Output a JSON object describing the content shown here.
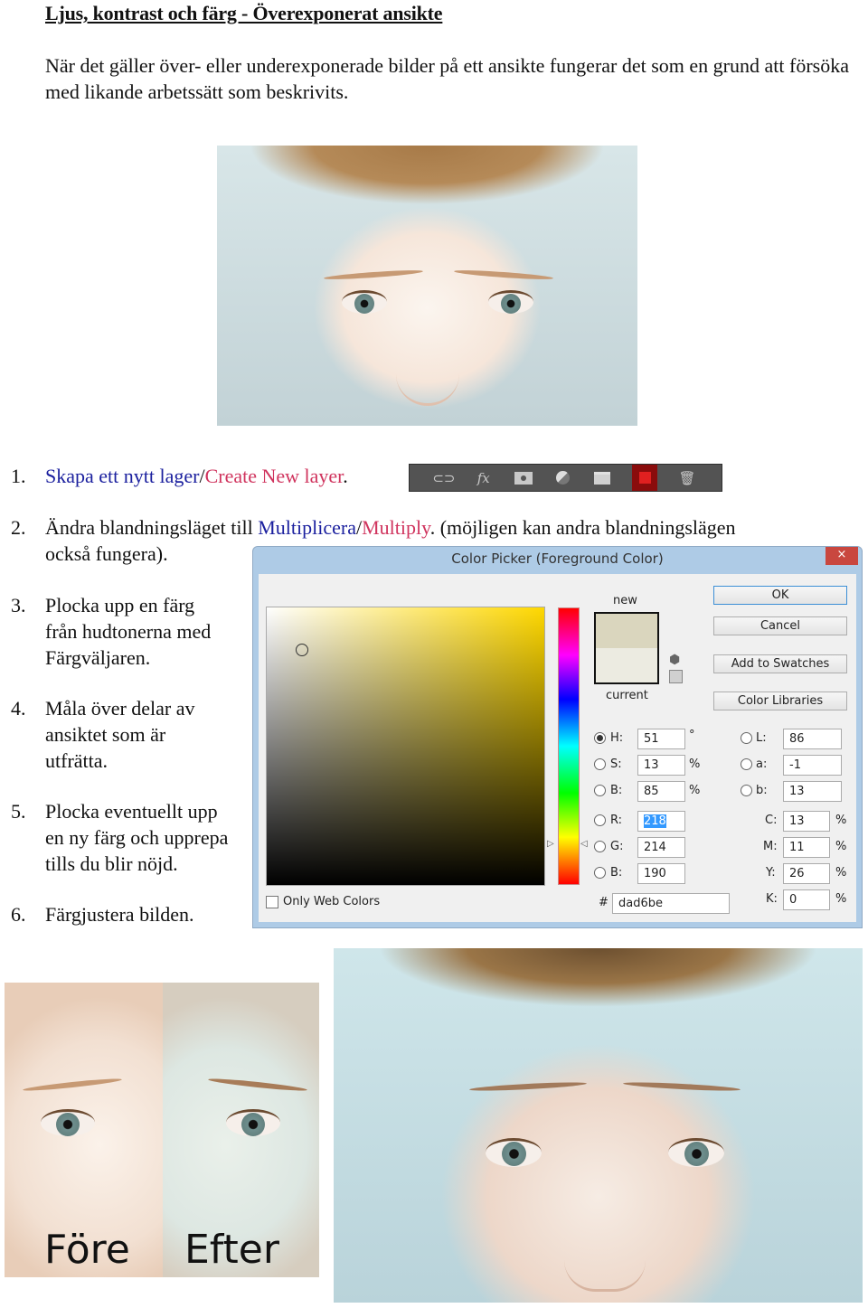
{
  "document": {
    "title": "Ljus, kontrast och färg   -  Överexponerat ansikte",
    "intro": "När det gäller över- eller underexponerade bilder på ett ansikte fungerar det som en grund att försöka med likande arbetssätt som beskrivits."
  },
  "steps": [
    {
      "num": "1.",
      "swedish": "Skapa ett nytt lager",
      "sep": "/",
      "english": "Create New layer",
      "tail": "."
    },
    {
      "num": "2.",
      "pre": "Ändra blandningsläget till ",
      "swedish": "Multiplicera",
      "sep": "/",
      "english": "Multiply",
      "tail": ". (möjligen kan andra blandningslägen",
      "line2": "också fungera)."
    },
    {
      "num": "3.",
      "lines": [
        "Plocka upp en färg",
        "från hudtonerna med",
        "Färgväljaren."
      ]
    },
    {
      "num": "4.",
      "lines": [
        "Måla över delar av",
        "ansiktet som är",
        "utfrätta."
      ]
    },
    {
      "num": "5.",
      "lines": [
        "Plocka eventuellt upp",
        "en ny färg och upprepa",
        "tills du blir nöjd."
      ]
    },
    {
      "num": "6.",
      "lines": [
        "Färgjustera bilden."
      ]
    }
  ],
  "layers_toolbar": {
    "icons": [
      "link-layers-icon",
      "fx-icon",
      "add-mask-icon",
      "adjustment-layer-icon",
      "group-folder-icon",
      "new-layer-icon",
      "trash-icon"
    ],
    "fx_label": "fx",
    "highlighted": "new-layer-icon"
  },
  "color_picker": {
    "title": "Color Picker (Foreground Color)",
    "close_label": "×",
    "new_label": "new",
    "current_label": "current",
    "new_color": "#dad6be",
    "current_color": "#ecebe1",
    "buttons": {
      "ok": "OK",
      "cancel": "Cancel",
      "add_swatches": "Add to Swatches",
      "libraries": "Color Libraries"
    },
    "hsb": [
      {
        "label": "H:",
        "value": "51",
        "unit": "°",
        "selected": true
      },
      {
        "label": "S:",
        "value": "13",
        "unit": "%"
      },
      {
        "label": "B:",
        "value": "85",
        "unit": "%"
      }
    ],
    "rgb": [
      {
        "label": "R:",
        "value": "218"
      },
      {
        "label": "G:",
        "value": "214"
      },
      {
        "label": "B:",
        "value": "190"
      }
    ],
    "lab": [
      {
        "label": "L:",
        "value": "86"
      },
      {
        "label": "a:",
        "value": "-1"
      },
      {
        "label": "b:",
        "value": "13"
      }
    ],
    "cmyk": [
      {
        "label": "C:",
        "value": "13",
        "unit": "%"
      },
      {
        "label": "M:",
        "value": "11",
        "unit": "%"
      },
      {
        "label": "Y:",
        "value": "26",
        "unit": "%"
      },
      {
        "label": "K:",
        "value": "0",
        "unit": "%"
      }
    ],
    "hex_label": "#",
    "hex": "dad6be",
    "only_web_colors": "Only Web Colors",
    "hue_degrees": 51
  },
  "captions": {
    "before": "Före",
    "after": "Efter"
  }
}
